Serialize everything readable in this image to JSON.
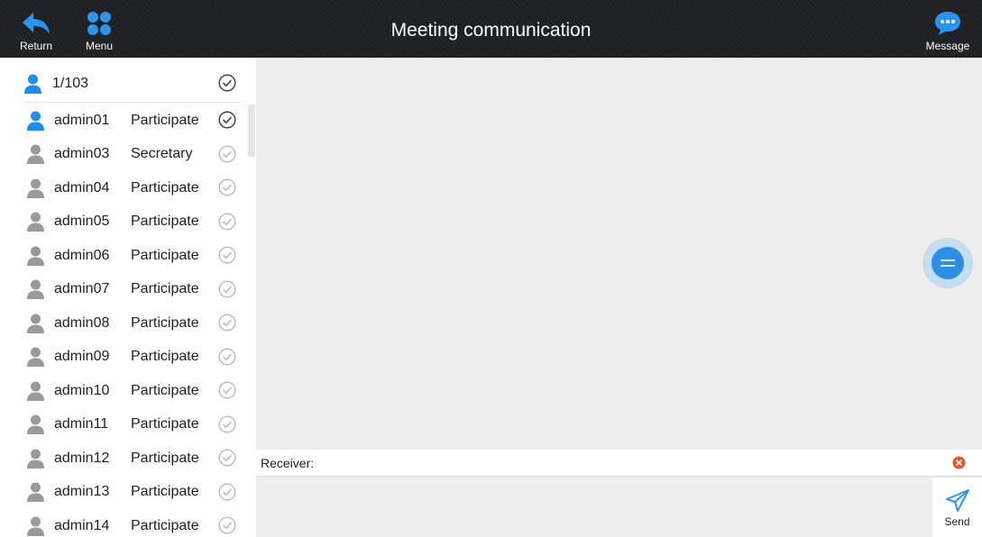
{
  "header": {
    "title": "Meeting communication",
    "return_label": "Return",
    "menu_label": "Menu",
    "message_label": "Message"
  },
  "sidebar": {
    "summary_count": "1/103",
    "participants": [
      {
        "name": "admin01",
        "role": "Participate",
        "active": true
      },
      {
        "name": "admin03",
        "role": "Secretary",
        "active": false
      },
      {
        "name": "admin04",
        "role": "Participate",
        "active": false
      },
      {
        "name": "admin05",
        "role": "Participate",
        "active": false
      },
      {
        "name": "admin06",
        "role": "Participate",
        "active": false
      },
      {
        "name": "admin07",
        "role": "Participate",
        "active": false
      },
      {
        "name": "admin08",
        "role": "Participate",
        "active": false
      },
      {
        "name": "admin09",
        "role": "Participate",
        "active": false
      },
      {
        "name": "admin10",
        "role": "Participate",
        "active": false
      },
      {
        "name": "admin11",
        "role": "Participate",
        "active": false
      },
      {
        "name": "admin12",
        "role": "Participate",
        "active": false
      },
      {
        "name": "admin13",
        "role": "Participate",
        "active": false
      },
      {
        "name": "admin14",
        "role": "Participate",
        "active": false
      }
    ]
  },
  "compose": {
    "receiver_label": "Receiver:",
    "send_label": "Send"
  },
  "icons": {
    "return": "return-arrow-icon",
    "menu": "grid-menu-icon",
    "message": "chat-bubble-icon",
    "user_active": "user-icon-blue",
    "user_inactive": "user-icon-gray",
    "check": "check-circle-icon",
    "clear": "clear-x-icon",
    "send": "paper-plane-icon",
    "fab": "floating-menu-icon"
  },
  "colors": {
    "topbar": "#1d1f22",
    "accent": "#1f8ee8",
    "inactive_icon": "#9a9a9a",
    "clear": "#e8572a"
  }
}
